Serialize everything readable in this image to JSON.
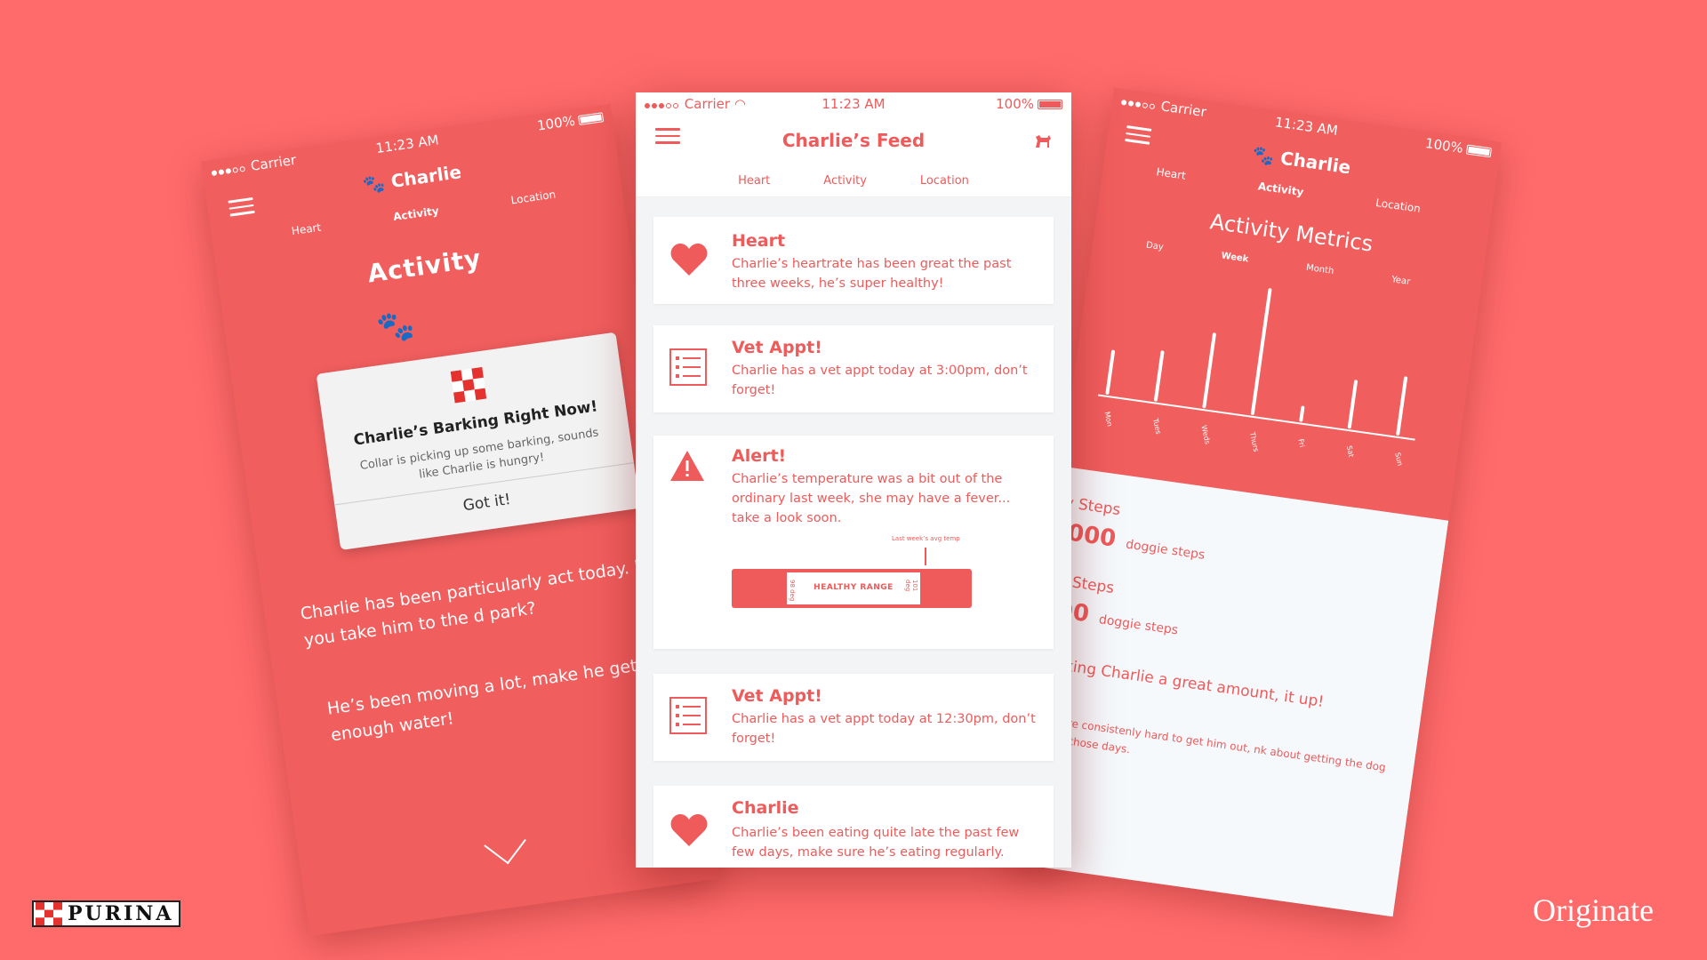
{
  "colors": {
    "background": "#ff6b6b",
    "accent": "#ef5a5a",
    "card": "#ffffff"
  },
  "status_bar": {
    "carrier": "Carrier",
    "time": "11:23 AM",
    "battery": "100%"
  },
  "left_phone": {
    "title": "Charlie",
    "tabs": [
      "Heart",
      "Activity",
      "Location"
    ],
    "heading": "Activity",
    "modal": {
      "title": "Charlie’s Barking Right Now!",
      "body": "Collar is picking up some barking, sounds like Charlie is hungry!",
      "button": "Got it!"
    },
    "paragraph1": "Charlie has been particularly act today. Did you take him to the d park?",
    "paragraph2": "He’s been moving a lot, make he gets enough water!"
  },
  "center_phone": {
    "title": "Charlie’s Feed",
    "tabs": [
      "Heart",
      "Activity",
      "Location"
    ],
    "cards": [
      {
        "icon": "heart-icon",
        "title": "Heart",
        "body": "Charlie’s heartrate has been great the past three weeks, he’s super healthy!"
      },
      {
        "icon": "checklist-icon",
        "title": "Vet Appt!",
        "body": "Charlie has a vet appt today at 3:00pm, don’t forget!"
      },
      {
        "icon": "alert-icon",
        "title": "Alert!",
        "body": "Charlie’s temperature was a bit out of the ordinary last week, she may have a fever... take a look soon.",
        "range_label": "HEALTHY RANGE",
        "range_low": "98 deg",
        "range_high": "101 deg",
        "marker_label": "Last week’s avg temp"
      },
      {
        "icon": "checklist-icon",
        "title": "Vet Appt!",
        "body": "Charlie has a vet appt today at 12:30pm, don’t forget!"
      },
      {
        "icon": "heart-icon",
        "title": "Charlie",
        "body": "Charlie’s been eating quite late the past few few days, make sure he’s eating regularly."
      }
    ]
  },
  "right_phone": {
    "title": "Charlie",
    "tabs": [
      "Heart",
      "Activity",
      "Location"
    ],
    "heading": "Activity Metrics",
    "ranges": [
      "Day",
      "Week",
      "Month",
      "Year"
    ],
    "daily_label": "aily Steps",
    "daily_value": "2,000",
    "daily_unit": "doggie steps",
    "weekly_label": "ekly Steps",
    "weekly_value": ",000",
    "weekly_unit": "doggie steps",
    "text1": "e walking Charlie a great amount, it up!",
    "text2": "Friday’s are consistenly hard to get him out, nk about getting the dog walker on those days."
  },
  "chart_data": {
    "type": "bar",
    "categories": [
      "Mon",
      "Tues",
      "Weds",
      "Thurs",
      "Fri",
      "Sat",
      "Sun"
    ],
    "values": [
      40,
      46,
      70,
      120,
      12,
      44,
      54
    ]
  },
  "logos": {
    "purina": "PURINA",
    "originate": "Originate"
  }
}
